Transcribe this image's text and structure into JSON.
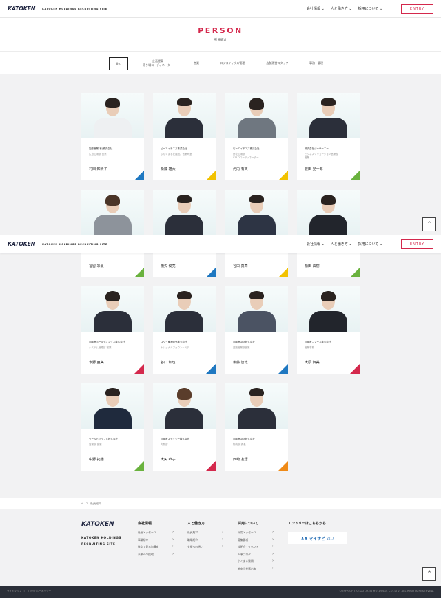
{
  "header": {
    "logo": "KATOKEN",
    "site": "KATOKEN HOLDINGS RECRUITING SITE",
    "nav": [
      "会社情報 ⌄",
      "人と働き方 ⌄",
      "採用について ⌄"
    ],
    "entry": "ENTRY"
  },
  "page": {
    "title": "PERSON",
    "subtitle": "社員紹介"
  },
  "filters": [
    "全て",
    "企画提案\n売り場コーディネーター",
    "営業",
    "ロジスティクス管理",
    "店舗運営スタッフ",
    "事務・管理"
  ],
  "cards": [
    {
      "company": "加藤産業(株)株式会社",
      "dept": "広島山陽部 営業",
      "name": "村田 知貴子",
      "accent": "#1f78c1"
    },
    {
      "company": "ビーエイチエス株式会社",
      "dept": "ぶんぐまる社員団、営業司室",
      "name": "新藤 雄大",
      "accent": "#f2c200"
    },
    {
      "company": "ビーエイチエス株式会社",
      "dept": "野花山陽部\nV.M.Dコーディネーター",
      "name": "河内 有美",
      "accent": "#f2c200"
    },
    {
      "company": "株式会社ジーサーエー",
      "dept": "ビジネスソリューション営業部\n営業",
      "name": "豊田 晃一郎",
      "accent": "#6ab23e"
    },
    {
      "company": "",
      "dept": "",
      "name": "福留 彩夏",
      "accent": "#6ab23e"
    },
    {
      "company": "",
      "dept": "",
      "name": "横矢 俊亮",
      "accent": "#1f78c1"
    },
    {
      "company": "",
      "dept": "",
      "name": "谷口 真司",
      "accent": "#f2c200"
    },
    {
      "company": "",
      "dept": "",
      "name": "松田 由樹",
      "accent": "#6ab23e"
    },
    {
      "company": "加藤産ホールディングス株式会社",
      "dept": "システム管理部 営業",
      "name": "水野 亜美",
      "accent": "#d4284c"
    },
    {
      "company": "コクヨ東海販売株式会社",
      "dept": "ナショナルアカウント2部",
      "name": "谷口 和也",
      "accent": "#1f78c1"
    },
    {
      "company": "加藤産GRS株式会社",
      "dept": "直販営業部営業",
      "name": "後藤 智史",
      "accent": "#1f78c1"
    },
    {
      "company": "加藤産コマース株式会社",
      "dept": "営業事務",
      "name": "大原 舞美",
      "accent": "#d4284c"
    },
    {
      "company": "ワールドクラフト株式会社",
      "dept": "営業部 営業",
      "name": "中野 拓通",
      "accent": "#6ab23e"
    },
    {
      "company": "加藤産ステイシー株式会社",
      "dept": "内勤部",
      "name": "大矢 恭子",
      "accent": "#d4284c"
    },
    {
      "company": "加藤産GRS株式会社",
      "dept": "物流部 課長",
      "name": "西崎 友悟",
      "accent": "#ef8a17"
    }
  ],
  "breadcrumb": {
    "home": "⌂",
    "sep": ">",
    "current": "社員紹介"
  },
  "footer": {
    "logo": "KATOKEN",
    "site": "KATOKEN HOLDINGS\nRECRUITING SITE",
    "cols": [
      {
        "title": "会社情報",
        "links": [
          "社長メッセージ",
          "事業紹介",
          "数字で見る加藤産",
          "未来への挑戦"
        ]
      },
      {
        "title": "人と働き方",
        "links": [
          "社員紹介",
          "職場紹介",
          "支援への想い"
        ]
      },
      {
        "title": "採用について",
        "links": [
          "採用メッセージ",
          "募集要項",
          "説明会・イベント",
          "人事ブログ",
          "よくある質問",
          "新卒当社選出来"
        ]
      }
    ],
    "entry_title": "エントリーはこちらから",
    "mynavi": "マイナビ",
    "mynavi_year": "2017",
    "bottom_left": "サイトマップ　|　プライバシーポリシー",
    "copyright": "COPYRIGHT(C)KATOKEN HOLDINGS CO.,LTD. ALL RIGHTS RESERVED."
  }
}
